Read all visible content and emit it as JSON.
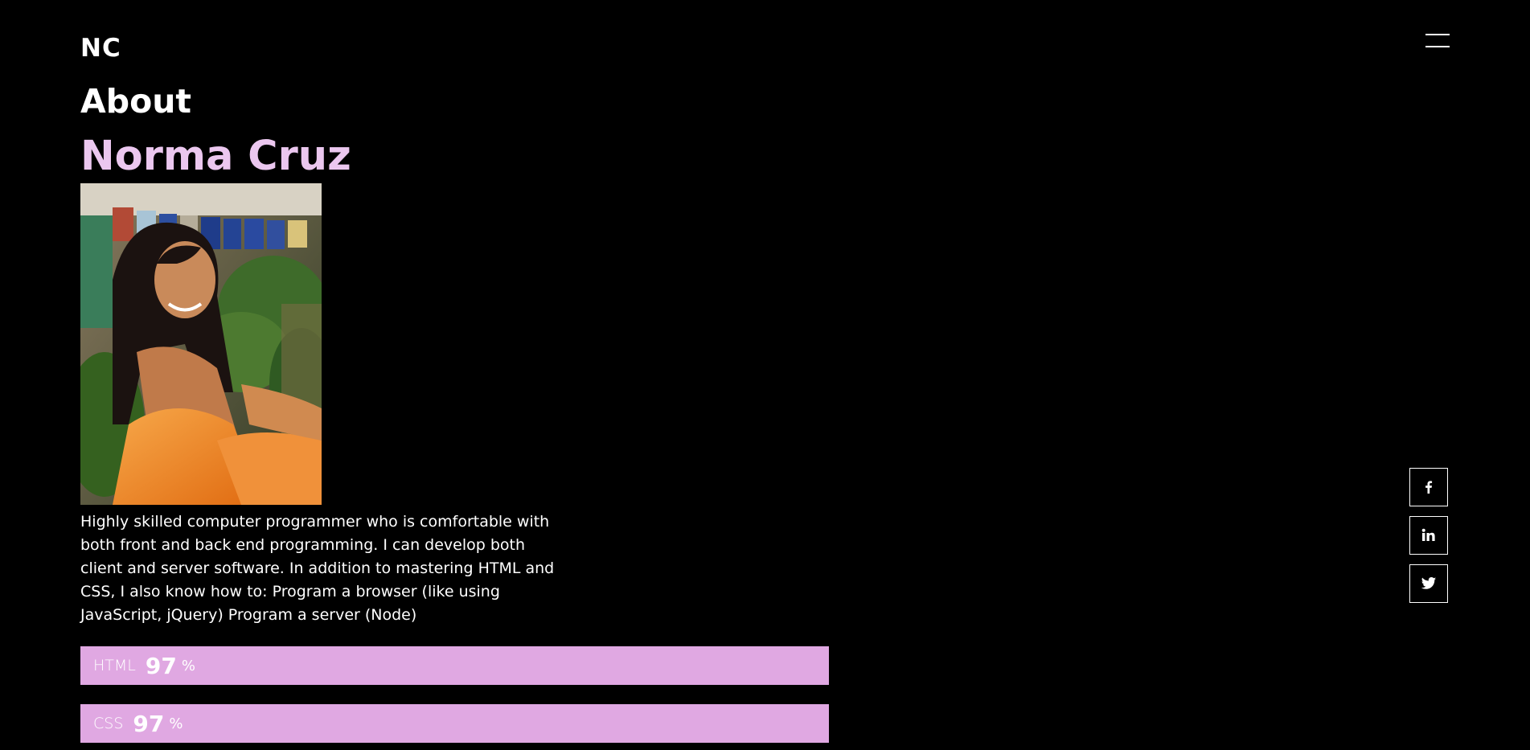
{
  "header": {
    "logo": "NC",
    "menu_icon": "hamburger-menu-icon"
  },
  "about": {
    "section_title": "About",
    "name": "Norma Cruz",
    "bio": "Highly skilled computer programmer who is comfortable with both front and back end programming. I can develop both client and server software. In addition to mastering HTML and CSS, I also know how to: Program a browser (like using JavaScript, jQuery) Program a server (Node)"
  },
  "skills": [
    {
      "name": "HTML",
      "value": "97",
      "unit": "%",
      "fraction": 0.97
    },
    {
      "name": "CSS",
      "value": "97",
      "unit": "%",
      "fraction": 0.97
    }
  ],
  "social": [
    {
      "icon": "facebook-icon"
    },
    {
      "icon": "linkedin-icon"
    },
    {
      "icon": "twitter-icon"
    }
  ],
  "colors": {
    "background": "#000000",
    "text": "#ffffff",
    "name_accent": "#ebc7ef",
    "skill_bar": "#e0a8e2"
  }
}
